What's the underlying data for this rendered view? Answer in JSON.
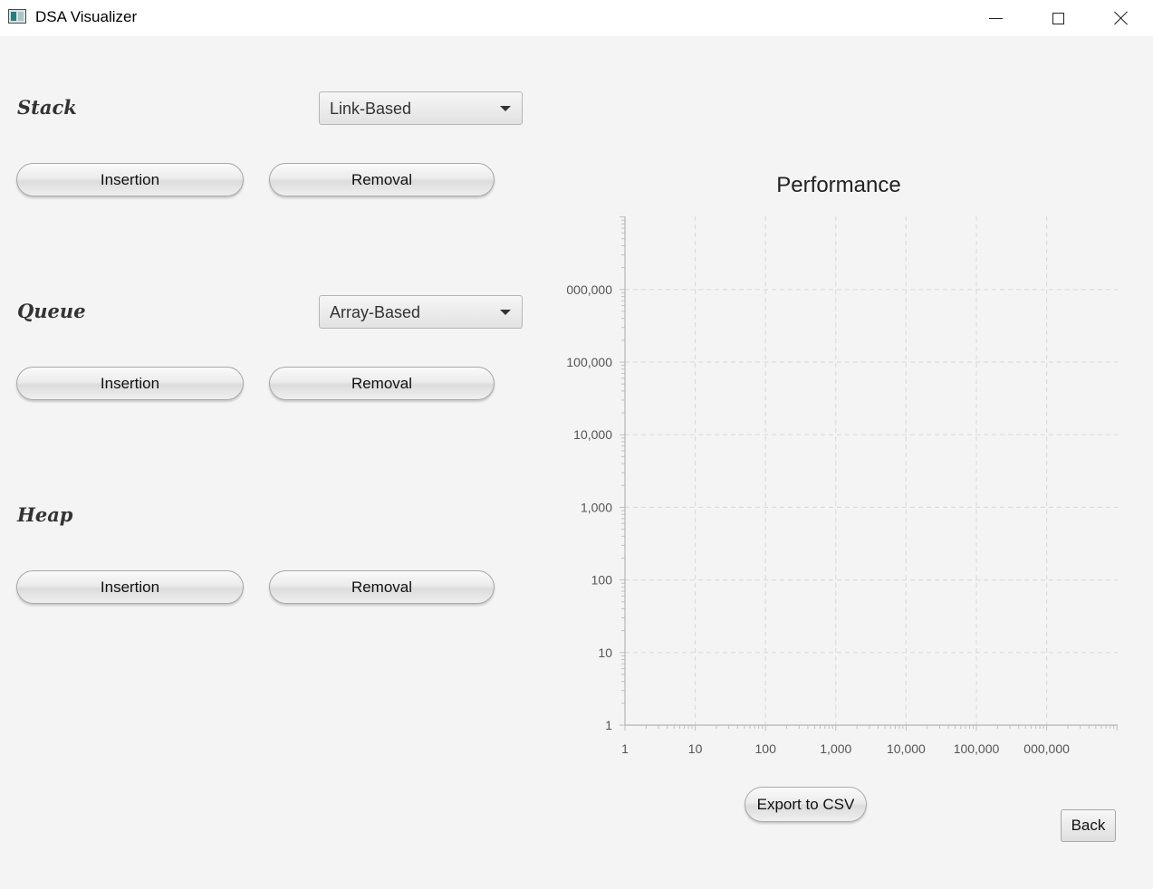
{
  "window": {
    "title": "DSA Visualizer",
    "controls": [
      "minimize-icon",
      "maximize-icon",
      "close-icon"
    ]
  },
  "panels": {
    "stack": {
      "label": "Stack",
      "implementation": "Link-Based",
      "insert_label": "Insertion",
      "remove_label": "Removal"
    },
    "queue": {
      "label": "Queue",
      "implementation": "Array-Based",
      "insert_label": "Insertion",
      "remove_label": "Removal"
    },
    "heap": {
      "label": "Heap",
      "insert_label": "Insertion",
      "remove_label": "Removal"
    }
  },
  "chart_data": {
    "type": "line",
    "title": "Performance",
    "x_scale": "log",
    "y_scale": "log",
    "x_ticks": [
      "1",
      "10",
      "100",
      "1,000",
      "10,000",
      "100,000",
      "000,000"
    ],
    "y_ticks": [
      "1",
      "10",
      "100",
      "1,000",
      "10,000",
      "100,000",
      "000,000"
    ],
    "xlim": [
      1,
      10000000
    ],
    "ylim": [
      1,
      10000000
    ],
    "grid": true,
    "series": []
  },
  "actions": {
    "export_label": "Export to CSV",
    "back_label": "Back"
  }
}
